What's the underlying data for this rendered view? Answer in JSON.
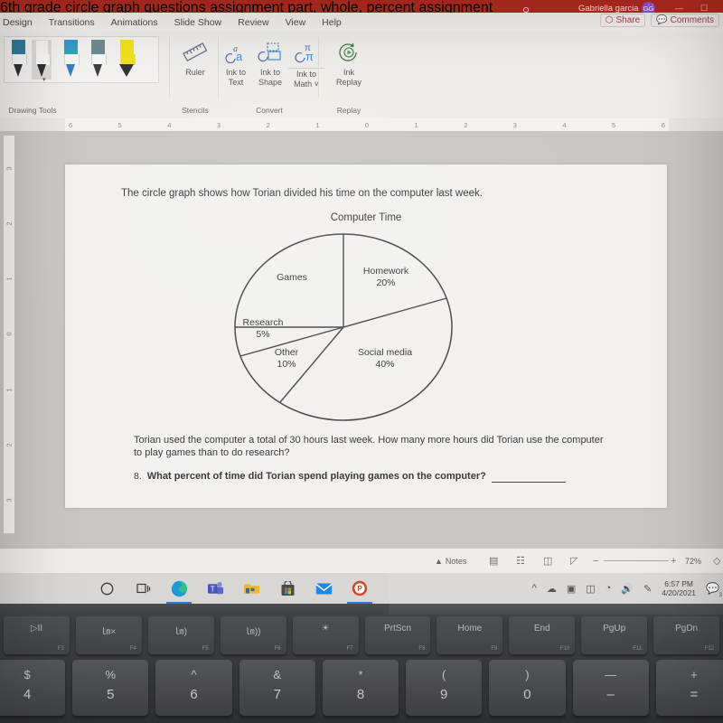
{
  "window": {
    "title": "6th grade circle graph questions assignment part, whole, percent assignment",
    "title_dropdown_icon": "chevron-down-icon",
    "search_icon": "search-icon",
    "account_name": "Gabriella garcia",
    "account_initials": "GG",
    "restore_icon": "restore-down-icon",
    "minimize_icon": "minimize-icon",
    "maximize_icon": "maximize-icon"
  },
  "ribbon": {
    "tabs": [
      {
        "label": "Design"
      },
      {
        "label": "Transitions"
      },
      {
        "label": "Animations"
      },
      {
        "label": "Slide Show"
      },
      {
        "label": "Review"
      },
      {
        "label": "View"
      },
      {
        "label": "Help"
      }
    ],
    "share_label": "Share",
    "share_icon": "share-icon",
    "comments_label": "Comments",
    "comments_icon": "comment-icon",
    "groups": [
      {
        "name": "Drawing Tools",
        "label": "Drawing Tools"
      },
      {
        "name": "Stencils",
        "label": "Stencils"
      },
      {
        "name": "Convert",
        "label": "Convert"
      },
      {
        "name": "Replay",
        "label": "Replay"
      }
    ],
    "pens": [
      {
        "name": "pen-teal",
        "cap": "#2e7c96"
      },
      {
        "name": "pen-black-selected",
        "cap": "#f6f5f4"
      },
      {
        "name": "pen-blue",
        "cap": "#2b6fd6"
      },
      {
        "name": "pen-gray-galaxy",
        "cap": "#6d8b92"
      },
      {
        "name": "highlighter-yellow",
        "cap": "#f2e21a"
      }
    ],
    "buttons": [
      {
        "name": "ruler-button",
        "label": "Ruler",
        "icon": "ruler-icon"
      },
      {
        "name": "ink-to-text-button",
        "label": "Ink to\nText",
        "line1": "Ink to",
        "line2": "Text",
        "icon": "ink-to-text-icon"
      },
      {
        "name": "ink-to-shape-button",
        "label": "Ink to Shape",
        "line1": "Ink to",
        "line2": "Shape",
        "icon": "ink-to-shape-icon"
      },
      {
        "name": "ink-to-math-button",
        "label": "Ink to Math",
        "line1": "Ink to",
        "line2": "Math ˅",
        "icon": "ink-to-math-icon"
      },
      {
        "name": "ink-replay-button",
        "label": "Ink Replay",
        "line1": "Ink",
        "line2": "Replay",
        "icon": "ink-replay-icon"
      }
    ]
  },
  "rulers": {
    "horizontal_ticks": [
      "6",
      "5",
      "4",
      "3",
      "2",
      "1",
      "0",
      "1",
      "2",
      "3",
      "4",
      "5",
      "6"
    ],
    "vertical_ticks": [
      "3",
      "2",
      "1",
      "0",
      "1",
      "2",
      "3"
    ]
  },
  "slide": {
    "prompt": "The circle graph shows how  Torian divided his time on the computer last week.",
    "question_total": "Torian used the computer a total of 30 hours last week. How many more hours did Torian use the computer to play games than to do research?",
    "question8_number": "8.",
    "question8_text": "What percent of time did Torian spend playing games on the computer?",
    "answer_blank": ""
  },
  "chart_data": {
    "type": "pie",
    "title": "Computer Time",
    "categories": [
      "Homework",
      "Social media",
      "Other",
      "Research",
      "Games"
    ],
    "values": [
      20,
      40,
      10,
      5,
      25
    ],
    "labels": [
      {
        "name": "Homework",
        "percent": "20%",
        "line1": "Homework",
        "line2": "20%"
      },
      {
        "name": "Social media",
        "percent": "40%",
        "line1": "Social media",
        "line2": "40%"
      },
      {
        "name": "Other",
        "percent": "10%",
        "line1": "Other",
        "line2": "10%"
      },
      {
        "name": "Research",
        "percent": "5%",
        "line1": "Research",
        "line2": "5%"
      },
      {
        "name": "Games",
        "percent": "",
        "line1": "Games",
        "line2": ""
      }
    ],
    "start_angle_deg": 0,
    "direction": "clockwise",
    "stroke_color": "#4a4a4c",
    "fill_color": "none",
    "legend": "none",
    "grid": false
  },
  "statusbar": {
    "notes_label": "Notes",
    "notes_icon": "notes-icon",
    "view_normal_icon": "normal-view-icon",
    "view_sorter_icon": "slide-sorter-icon",
    "view_reading_icon": "reading-view-icon",
    "view_show_icon": "slide-show-icon",
    "zoom_out_icon": "minus-icon",
    "zoom_in_icon": "plus-icon",
    "zoom_percent": "72%",
    "fit_icon": "fit-slide-icon"
  },
  "taskbar": {
    "items": [
      {
        "name": "cortana-button",
        "icon": "circle-icon"
      },
      {
        "name": "task-view-button",
        "icon": "task-view-icon"
      },
      {
        "name": "edge-button",
        "icon": "edge-icon"
      },
      {
        "name": "teams-button",
        "icon": "teams-icon"
      },
      {
        "name": "file-explorer-button",
        "icon": "folder-icon"
      },
      {
        "name": "microsoft-store-button",
        "icon": "store-icon"
      },
      {
        "name": "mail-button",
        "icon": "mail-icon"
      },
      {
        "name": "powerpoint-button",
        "icon": "powerpoint-icon"
      }
    ],
    "tray": [
      {
        "name": "show-hidden-icons",
        "icon": "chevron-up-icon"
      },
      {
        "name": "onedrive-icon",
        "icon": "cloud-icon"
      },
      {
        "name": "screen-snip-icon",
        "icon": "picture-icon"
      },
      {
        "name": "battery-icon",
        "icon": "battery-icon"
      },
      {
        "name": "wifi-icon",
        "icon": "wifi-icon"
      },
      {
        "name": "volume-icon",
        "icon": "speaker-icon"
      },
      {
        "name": "pen-menu-icon",
        "icon": "pen-icon"
      }
    ],
    "time": "6:57 PM",
    "date": "4/20/2021",
    "notification_icon": "action-center-icon",
    "notification_count": "3"
  },
  "keyboard": {
    "function_keys": [
      {
        "glyph": "▷II",
        "fn": "F3"
      },
      {
        "glyph": "㏐×",
        "fn": "F4"
      },
      {
        "glyph": "㏐)",
        "fn": "F5"
      },
      {
        "glyph": "㏐))",
        "fn": "F6"
      },
      {
        "glyph": "☀",
        "fn": "F7"
      },
      {
        "glyph": "PrtScn",
        "fn": "F8"
      },
      {
        "glyph": "Home",
        "fn": "F9"
      },
      {
        "glyph": "End",
        "fn": "F10"
      },
      {
        "glyph": "PgUp",
        "fn": "F11"
      },
      {
        "glyph": "PgDn",
        "fn": "F12"
      }
    ],
    "number_keys": [
      {
        "upper": "$",
        "lower": "4"
      },
      {
        "upper": "%",
        "lower": "5"
      },
      {
        "upper": "^",
        "lower": "6"
      },
      {
        "upper": "&",
        "lower": "7"
      },
      {
        "upper": "*",
        "lower": "8"
      },
      {
        "upper": "(",
        "lower": "9"
      },
      {
        "upper": ")",
        "lower": "0"
      },
      {
        "upper": "—",
        "lower": "–"
      },
      {
        "upper": "+",
        "lower": "="
      }
    ]
  },
  "colors": {
    "brand_red": "#b52b1d",
    "accent_blue": "#2e7bd4",
    "avatar_purple": "#8a4fd8"
  }
}
